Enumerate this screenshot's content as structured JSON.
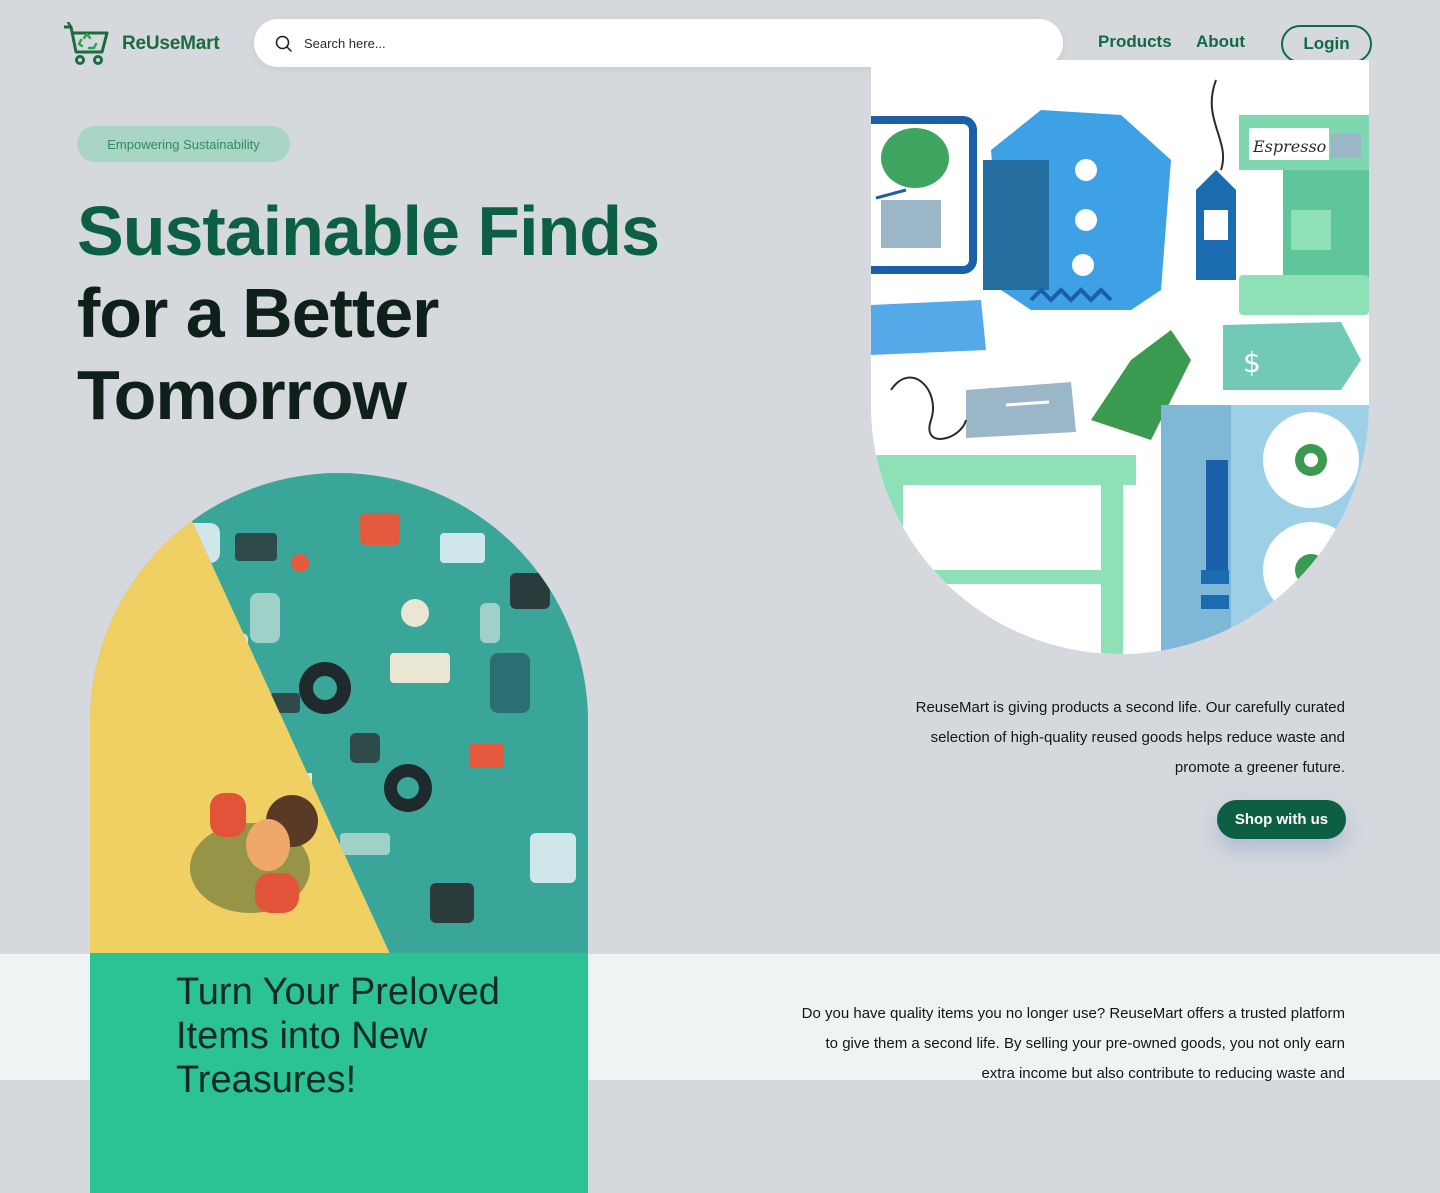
{
  "brand": {
    "name": "ReUseMart",
    "color": "#1c6b3c",
    "logo_icon": "recycle-cart-icon"
  },
  "header": {
    "search_placeholder": "Search here...",
    "nav": {
      "products": "Products",
      "about": "About"
    },
    "login_label": "Login"
  },
  "hero": {
    "tag": "Empowering Sustainability",
    "headline_accent": "Sustainable Finds",
    "headline_line2": "for a Better",
    "headline_line3": "Tomorrow",
    "description": "ReuseMart is giving products a second life. Our carefully curated selection of high-quality reused goods helps reduce waste and promote a greener future.",
    "cta_label": "Shop with us"
  },
  "section": {
    "title": "Turn Your Preloved Items into New Treasures!",
    "text": "Do you have quality items you no longer use? ReuseMart offers a trusted platform to give them a second life. By selling your pre-owned goods, you not only earn extra income but also contribute to reducing waste and"
  },
  "colors": {
    "page_bg": "#d5d8dd",
    "primary": "#0d5f44",
    "accent_green": "#2cc394",
    "tag_bg": "#a9d6c4",
    "band_bg": "#eef4f3"
  }
}
